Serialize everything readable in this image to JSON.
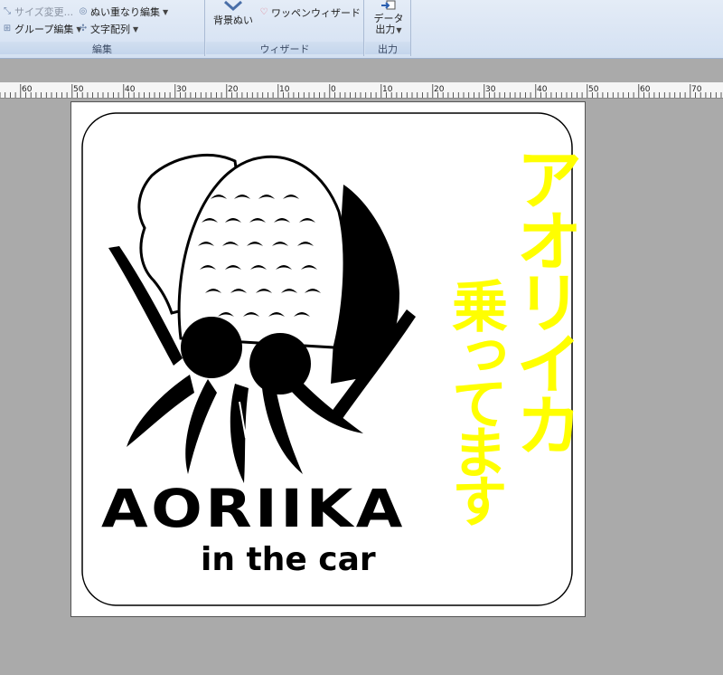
{
  "ribbon": {
    "edit_group": {
      "label": "編集",
      "resize_label": "サイズ変更...",
      "group_edit_label": "グループ編集",
      "stitch_overlap_label": "ぬい重なり編集",
      "text_layout_label": "文字配列"
    },
    "wizard_group": {
      "label": "ウィザード",
      "background_stitch_label": "背景ぬい",
      "patch_wizard_label": "ワッペンウィザード"
    },
    "output_group": {
      "label": "出力",
      "data_output_line1": "データ",
      "data_output_line2": "出力"
    }
  },
  "ruler": {
    "ticks": [
      "60",
      "50",
      "40",
      "30",
      "20",
      "10",
      "0",
      "10",
      "20",
      "30",
      "40",
      "50",
      "60",
      "70"
    ]
  },
  "design": {
    "title": "AORIIKA",
    "subtitle": "in the car",
    "vertical_line1": "アオリイカ",
    "vertical_line2": "乗ってます",
    "text_color": "#000000",
    "accent_color": "#ffff00"
  },
  "colors": {
    "ribbon_bg": "#dbe6f4",
    "workspace_bg": "#aaaaaa",
    "page_bg": "#ffffff"
  }
}
